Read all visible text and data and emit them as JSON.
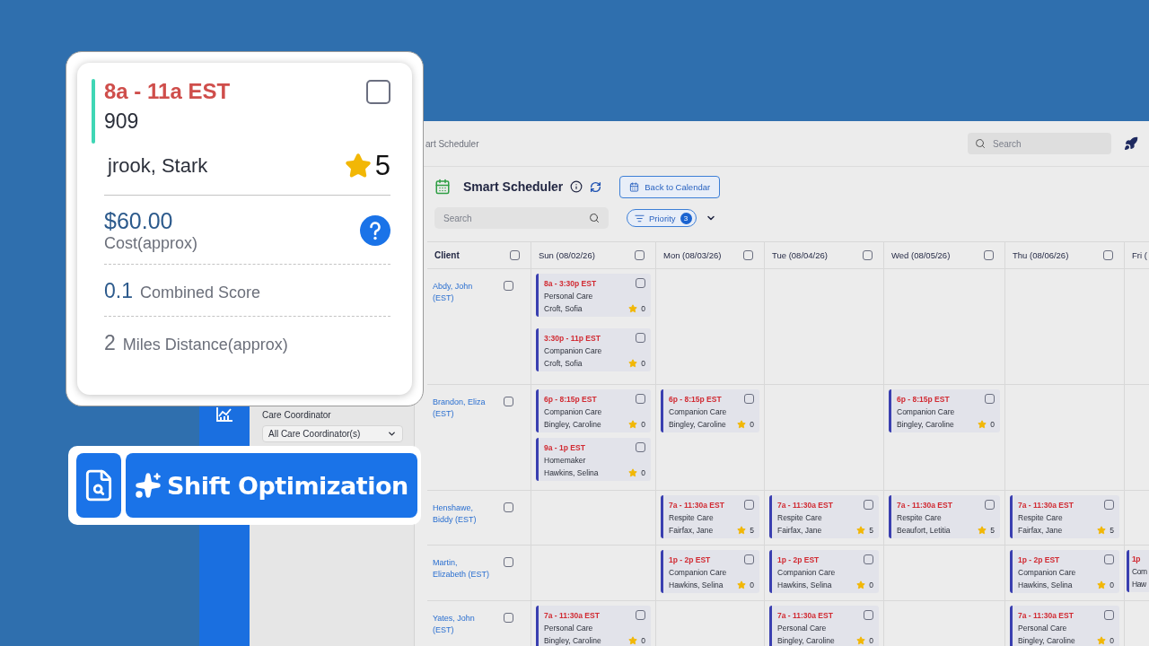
{
  "topbar": {
    "breadcrumb": "art Scheduler",
    "search": {
      "placeholder": "Search"
    }
  },
  "filters": {
    "label": "Care Coordinator",
    "value": "All Care Coordinator(s)"
  },
  "header": {
    "title": "Smart Scheduler",
    "back_button": "Back to Calendar",
    "search": {
      "placeholder": "Search"
    },
    "priority": {
      "label": "Priority",
      "count": "3"
    }
  },
  "table": {
    "columns": [
      {
        "label": "Client",
        "checked": false
      },
      {
        "label": "Sun (08/02/26)",
        "checked": false
      },
      {
        "label": "Mon (08/03/26)",
        "checked": false
      },
      {
        "label": "Tue (08/04/26)",
        "checked": false
      },
      {
        "label": "Wed (08/05/26)",
        "checked": false
      },
      {
        "label": "Thu (08/06/26)",
        "checked": false
      },
      {
        "label": "Fri ("
      }
    ],
    "rows": [
      {
        "cells": [
          {
            "kind": "client",
            "name": "Abdy, John (EST)",
            "checked": false
          },
          {
            "kind": "shifts",
            "shifts": [
              {
                "time": "8a - 3:30p EST",
                "service": "Personal Care",
                "caregiver": "Croft, Sofia",
                "rating": "0",
                "checked": false
              },
              {
                "time": "3:30p - 11p EST",
                "service": "Companion Care",
                "caregiver": "Croft, Sofia",
                "rating": "0",
                "checked": false
              }
            ]
          },
          {
            "kind": "shifts"
          },
          {
            "kind": "shifts"
          },
          {
            "kind": "shifts"
          },
          {
            "kind": "shifts"
          },
          {
            "kind": "shifts"
          }
        ]
      },
      {
        "cells": [
          {
            "kind": "client",
            "name": "Brandon, Eliza (EST)",
            "checked": false
          },
          {
            "kind": "shifts",
            "shifts": [
              {
                "time": "6p - 8:15p EST",
                "service": "Companion Care",
                "caregiver": "Bingley, Caroline",
                "rating": "0",
                "checked": false
              },
              {
                "time": "9a - 1p EST",
                "service": "Homemaker",
                "caregiver": "Hawkins, Selina",
                "rating": "0",
                "checked": false
              }
            ]
          },
          {
            "kind": "shifts",
            "shifts": [
              {
                "time": "6p - 8:15p EST",
                "service": "Companion Care",
                "caregiver": "Bingley, Caroline",
                "rating": "0",
                "checked": false
              }
            ]
          },
          {
            "kind": "shifts"
          },
          {
            "kind": "shifts",
            "shifts": [
              {
                "time": "6p - 8:15p EST",
                "service": "Companion Care",
                "caregiver": "Bingley, Caroline",
                "rating": "0",
                "checked": false
              }
            ]
          },
          {
            "kind": "shifts"
          },
          {
            "kind": "shifts"
          }
        ]
      },
      {
        "cells": [
          {
            "kind": "client",
            "name": "Henshawe, Biddy (EST)",
            "checked": false
          },
          {
            "kind": "shifts"
          },
          {
            "kind": "shifts",
            "shifts": [
              {
                "time": "7a - 11:30a EST",
                "service": "Respite Care",
                "caregiver": "Fairfax, Jane",
                "rating": "5",
                "checked": false
              }
            ]
          },
          {
            "kind": "shifts",
            "shifts": [
              {
                "time": "7a - 11:30a EST",
                "service": "Respite Care",
                "caregiver": "Fairfax, Jane",
                "rating": "5",
                "checked": false
              }
            ]
          },
          {
            "kind": "shifts",
            "shifts": [
              {
                "time": "7a - 11:30a EST",
                "service": "Respite Care",
                "caregiver": "Beaufort, Letitia",
                "rating": "5",
                "checked": false
              }
            ]
          },
          {
            "kind": "shifts",
            "shifts": [
              {
                "time": "7a - 11:30a EST",
                "service": "Respite Care",
                "caregiver": "Fairfax, Jane",
                "rating": "5",
                "checked": false
              }
            ]
          },
          {
            "kind": "shifts"
          }
        ]
      },
      {
        "cells": [
          {
            "kind": "client",
            "name": "Martin, Elizabeth (EST)",
            "checked": false
          },
          {
            "kind": "shifts"
          },
          {
            "kind": "shifts",
            "shifts": [
              {
                "time": "1p - 2p EST",
                "service": "Companion Care",
                "caregiver": "Hawkins, Selina",
                "rating": "0",
                "checked": false
              }
            ]
          },
          {
            "kind": "shifts",
            "shifts": [
              {
                "time": "1p - 2p EST",
                "service": "Companion Care",
                "caregiver": "Hawkins, Selina",
                "rating": "0",
                "checked": false
              }
            ]
          },
          {
            "kind": "shifts"
          },
          {
            "kind": "shifts",
            "shifts": [
              {
                "time": "1p - 2p EST",
                "service": "Companion Care",
                "caregiver": "Hawkins, Selina",
                "rating": "0",
                "checked": false
              }
            ]
          },
          {
            "kind": "shifts",
            "shifts": [
              {
                "time": "1p",
                "service": "Com",
                "caregiver": "Haw"
              }
            ]
          }
        ]
      },
      {
        "cells": [
          {
            "kind": "client",
            "name": "Yates, John (EST)",
            "checked": false
          },
          {
            "kind": "shifts",
            "shifts": [
              {
                "time": "7a - 11:30a EST",
                "service": "Personal Care",
                "caregiver": "Bingley, Caroline",
                "rating": "0",
                "checked": false
              }
            ]
          },
          {
            "kind": "shifts"
          },
          {
            "kind": "shifts",
            "shifts": [
              {
                "time": "7a - 11:30a EST",
                "service": "Personal Care",
                "caregiver": "Bingley, Caroline",
                "rating": "0",
                "checked": false
              }
            ]
          },
          {
            "kind": "shifts"
          },
          {
            "kind": "shifts",
            "shifts": [
              {
                "time": "7a - 11:30a EST",
                "service": "Personal Care",
                "caregiver": "Bingley, Caroline",
                "rating": "0",
                "checked": false
              }
            ]
          },
          {
            "kind": "shifts"
          }
        ]
      }
    ]
  },
  "shift_card": {
    "time": "8a - 11a EST",
    "checked": false,
    "code": "909",
    "caregiver": "jrook, Stark",
    "rating": "5",
    "cost": "$60.00",
    "cost_label": "Cost(approx)",
    "score": "0.1",
    "score_label": "Combined Score",
    "distance": "2",
    "distance_label": "Miles Distance(approx)"
  },
  "optimization": {
    "label": "Shift Optimization"
  }
}
